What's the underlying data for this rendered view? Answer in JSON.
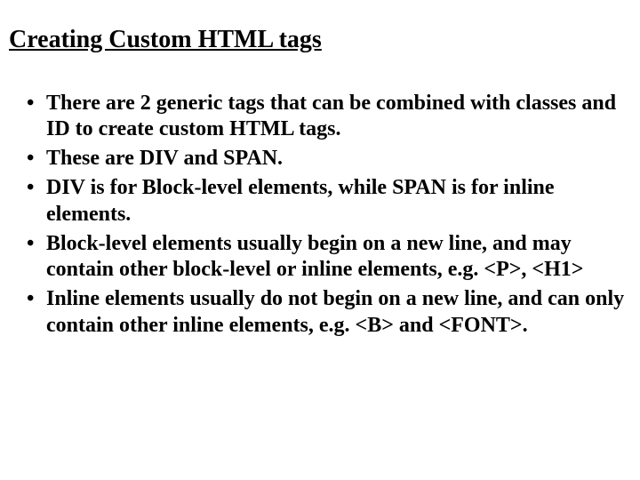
{
  "title": "Creating Custom HTML tags",
  "bullets": [
    "There are 2 generic tags that can be combined with classes and ID to create custom HTML tags.",
    "These are DIV and SPAN.",
    "DIV is for Block-level elements, while SPAN is for inline elements.",
    "Block-level elements usually begin on a new line, and may contain other block-level or inline elements, e.g. <P>, <H1>",
    "Inline elements usually do not begin on a new line, and can only contain other inline elements, e.g. <B> and <FONT>."
  ]
}
